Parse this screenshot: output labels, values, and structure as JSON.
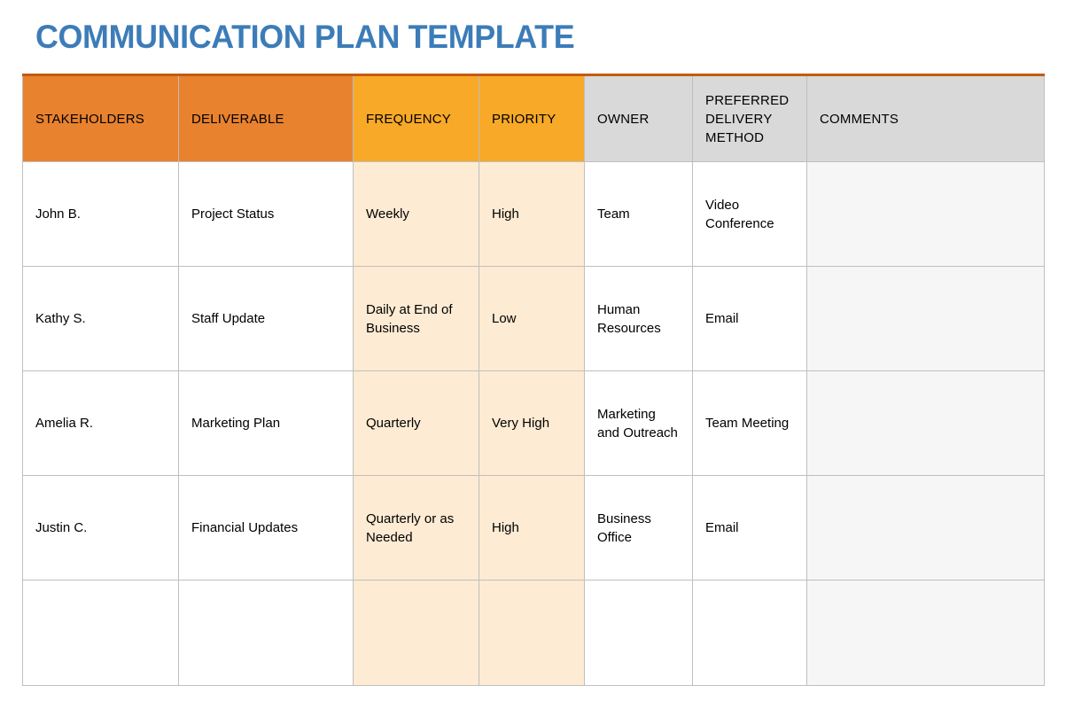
{
  "document": {
    "title": "COMMUNICATION PLAN TEMPLATE",
    "title_color": "#3c7cb8"
  },
  "colors": {
    "header_orange": "#e8822f",
    "header_amber": "#f7a927",
    "header_gray": "#d9d9d9",
    "cell_peach": "#fdebd3",
    "cell_gray": "#f6f6f6",
    "grid_line": "#bfbfbf",
    "top_border": "#c55a11"
  },
  "table": {
    "columns": [
      {
        "label": "STAKEHOLDERS",
        "style": "orange"
      },
      {
        "label": "DELIVERABLE",
        "style": "orange"
      },
      {
        "label": "FREQUENCY",
        "style": "amber"
      },
      {
        "label": "PRIORITY",
        "style": "amber"
      },
      {
        "label": "OWNER",
        "style": "gray"
      },
      {
        "label": "PREFERRED DELIVERY METHOD",
        "style": "gray"
      },
      {
        "label": "COMMENTS",
        "style": "gray"
      }
    ],
    "rows": [
      {
        "stakeholders": "John B.",
        "deliverable": "Project Status",
        "frequency": "Weekly",
        "priority": "High",
        "owner": "Team",
        "method": "Video Conference",
        "comments": ""
      },
      {
        "stakeholders": "Kathy S.",
        "deliverable": "Staff Update",
        "frequency": "Daily at End of Business",
        "priority": "Low",
        "owner": "Human Resources",
        "method": "Email",
        "comments": ""
      },
      {
        "stakeholders": "Amelia R.",
        "deliverable": "Marketing Plan",
        "frequency": "Quarterly",
        "priority": "Very High",
        "owner": "Marketing and Outreach",
        "method": "Team Meeting",
        "comments": ""
      },
      {
        "stakeholders": "Justin C.",
        "deliverable": "Financial Updates",
        "frequency": "Quarterly or as Needed",
        "priority": "High",
        "owner": "Business Office",
        "method": "Email",
        "comments": ""
      },
      {
        "stakeholders": "",
        "deliverable": "",
        "frequency": "",
        "priority": "",
        "owner": "",
        "method": "",
        "comments": ""
      }
    ]
  }
}
